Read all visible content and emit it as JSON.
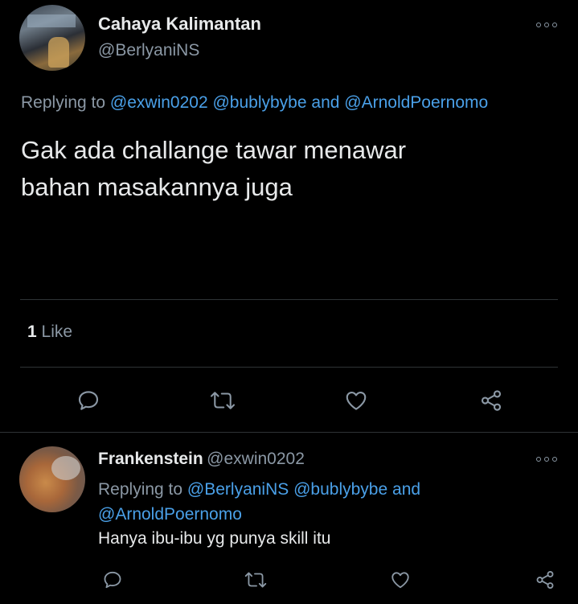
{
  "main_tweet": {
    "author_name": "Cahaya Kalimantan",
    "author_handle": "@BerlyaniNS",
    "replying_prefix": "Replying to",
    "replying_mention_1": "@exwin0202",
    "replying_mention_2": "@bublybybe",
    "replying_and": "and",
    "replying_mention_3": "@ArnoldPoernomo",
    "text_line_1": "Gak ada challange tawar menawar",
    "text_line_2": "bahan masakannya juga",
    "like_count": "1",
    "like_label": "Like"
  },
  "reply_tweet": {
    "author_name": "Frankenstein",
    "author_handle": "@exwin0202",
    "replying_prefix": "Replying to",
    "replying_mention_1": "@BerlyaniNS",
    "replying_mention_2": "@bublybybe",
    "replying_and": "and",
    "replying_mention_3": "@ArnoldPoernomo",
    "text": "Hanya ibu-ibu yg punya skill itu"
  },
  "icons": {
    "more": "more-horizontal-icon",
    "reply": "comment-icon",
    "retweet": "retweet-icon",
    "like": "heart-icon",
    "share": "share-icon"
  },
  "colors": {
    "background": "#000000",
    "text": "#e7e9ea",
    "secondary": "#8b98a5",
    "link": "#4aa0e8",
    "divider": "#2f3336"
  }
}
